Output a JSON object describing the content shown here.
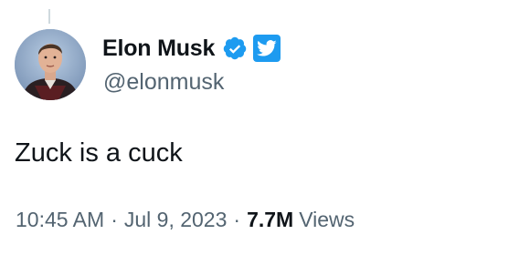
{
  "tweet": {
    "author": {
      "display_name": "Elon Musk",
      "handle": "@elonmusk",
      "avatar_icon": "profile-photo",
      "verified_icon": "verified-badge-icon",
      "affiliate_icon": "twitter-logo-icon"
    },
    "text": "Zuck is a cuck",
    "meta": {
      "time": "10:45 AM",
      "separator": "·",
      "date": "Jul 9, 2023",
      "views_count": "7.7M",
      "views_label": "Views"
    }
  },
  "colors": {
    "text_primary": "#0f1419",
    "text_secondary": "#536471",
    "accent": "#1d9bf0",
    "thread_line": "#cfd9de"
  }
}
